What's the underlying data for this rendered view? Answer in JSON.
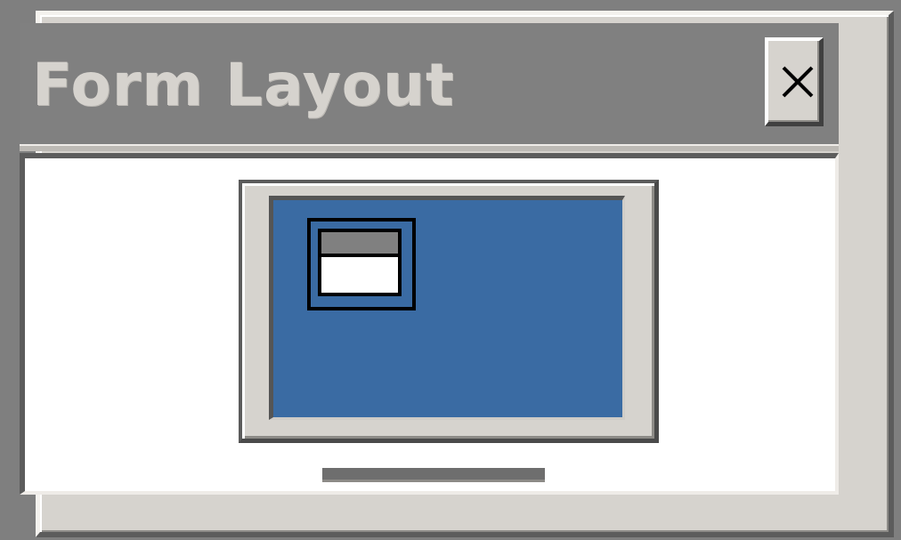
{
  "window": {
    "title": "Form Layout",
    "close_glyph": "×",
    "close_icon": "close-icon"
  },
  "preview": {
    "icon": "monitor-icon",
    "form_icon": "form-window-icon"
  },
  "colors": {
    "desktop": "#7f7f7f",
    "window_face": "#d6d3ce",
    "titlebar_inactive": "#808080",
    "title_text": "#d6d3ce",
    "client_bg": "#ffffff",
    "screen_blue": "#3a6ba3"
  }
}
